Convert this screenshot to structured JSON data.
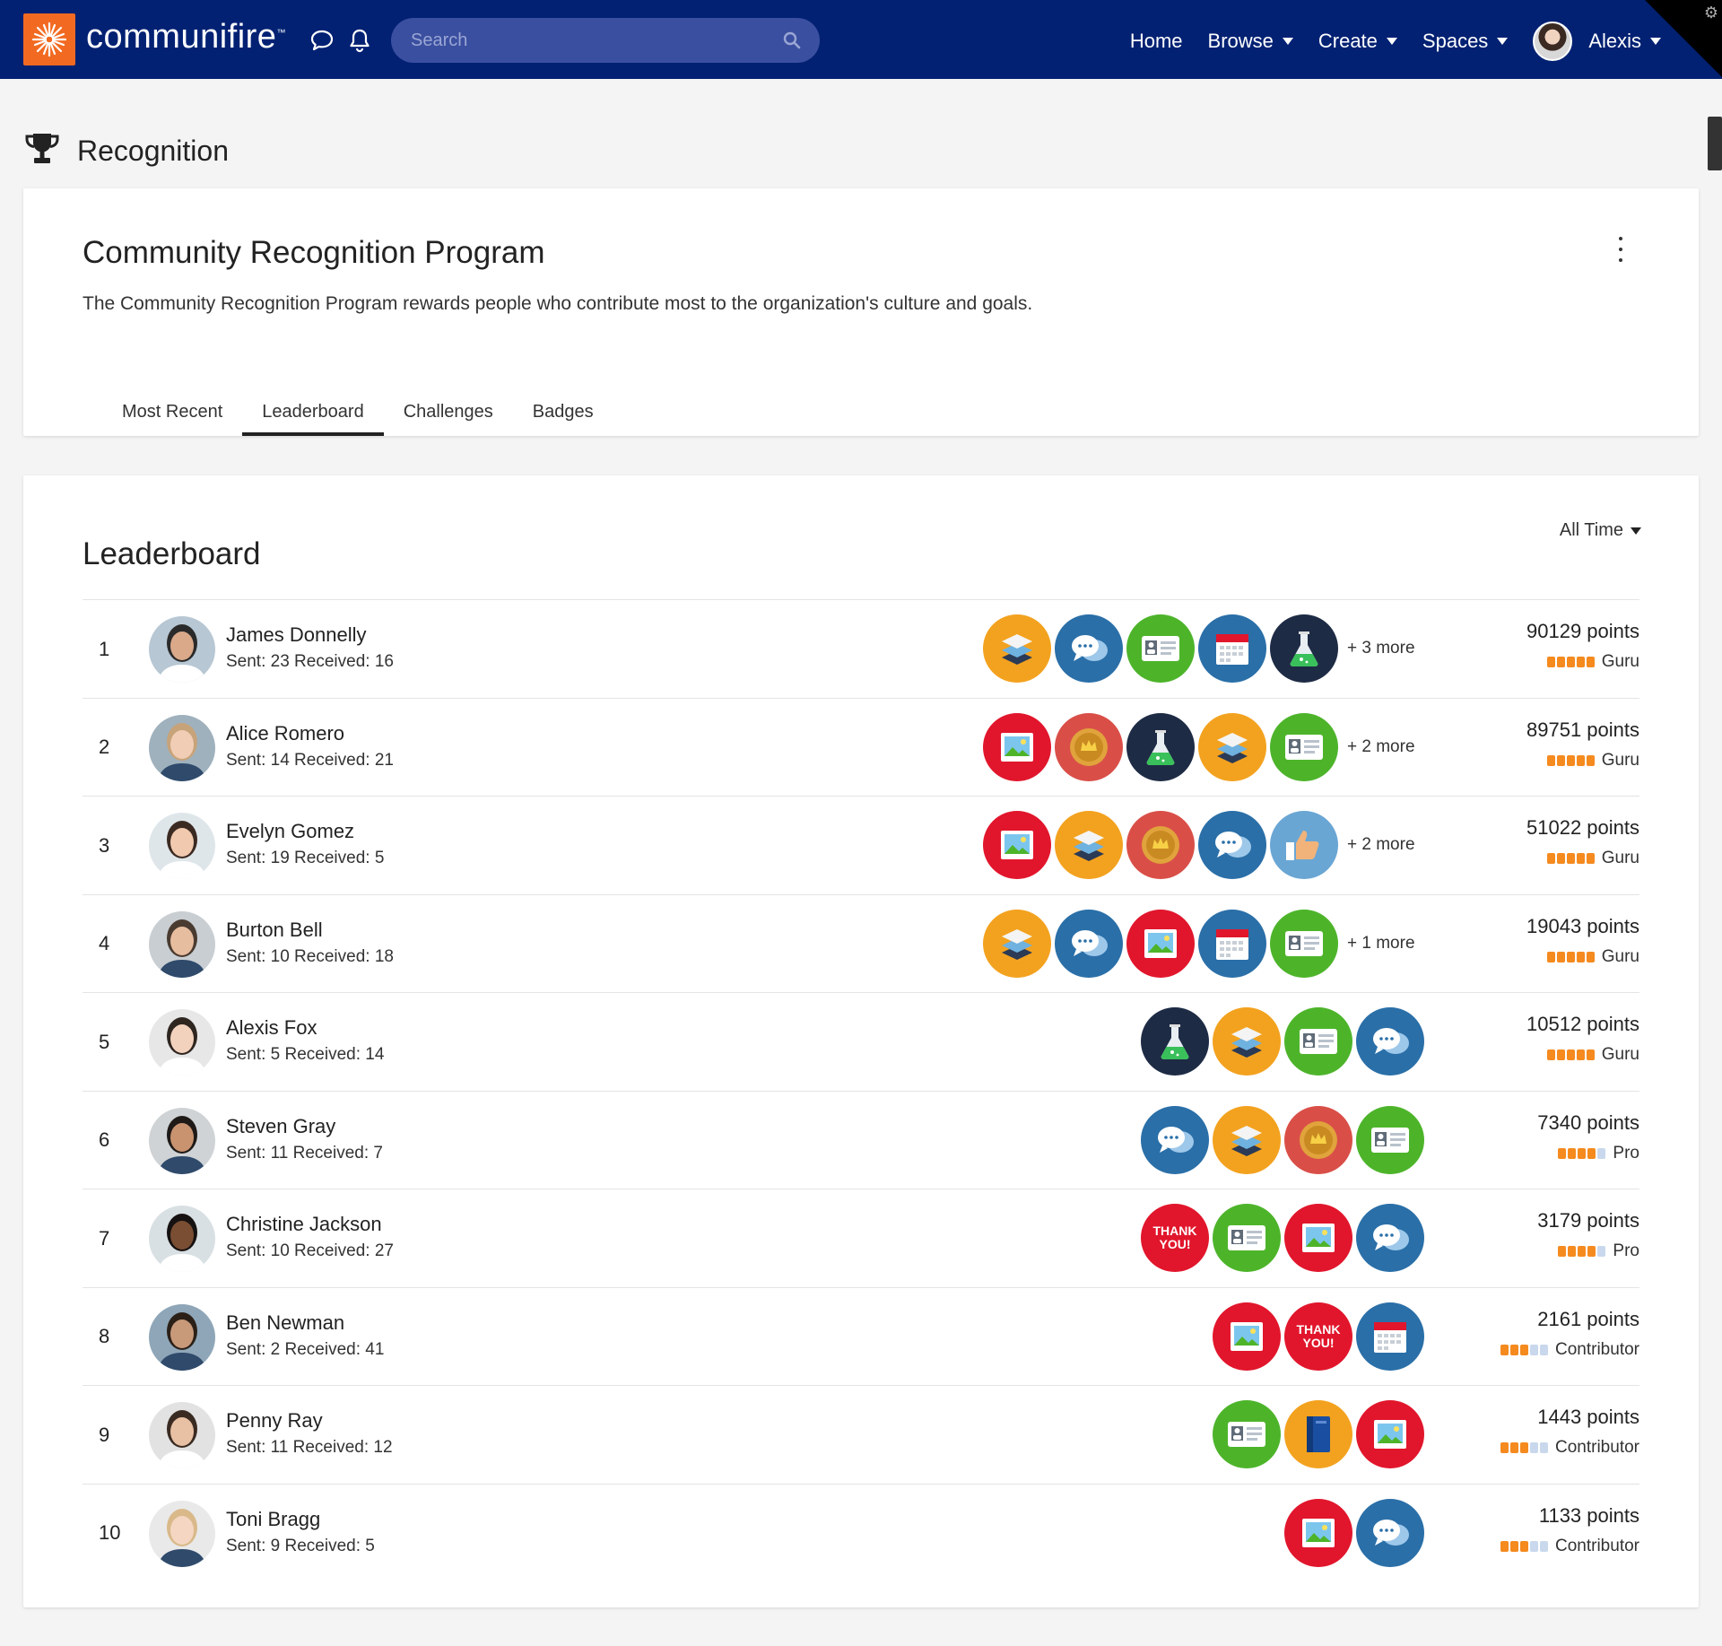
{
  "nav": {
    "brand": "communifire",
    "brand_tm": "™",
    "search_placeholder": "Search",
    "links": [
      {
        "label": "Home",
        "dropdown": false
      },
      {
        "label": "Browse",
        "dropdown": true
      },
      {
        "label": "Create",
        "dropdown": true
      },
      {
        "label": "Spaces",
        "dropdown": true
      }
    ],
    "user": "Alexis"
  },
  "page": {
    "title": "Recognition"
  },
  "program": {
    "title": "Community Recognition Program",
    "description": "The Community Recognition Program rewards people who contribute most to the organization's culture and goals.",
    "tabs": [
      "Most Recent",
      "Leaderboard",
      "Challenges",
      "Badges"
    ],
    "active_tab": "Leaderboard"
  },
  "leaderboard": {
    "title": "Leaderboard",
    "time_filter": "All Time",
    "rows": [
      {
        "rank": "1",
        "name": "James Donnelly",
        "stats": "Sent: 23 Received: 16",
        "badges": [
          "layers",
          "chat",
          "idcard",
          "calendar",
          "flask"
        ],
        "more": "+ 3 more",
        "points": "90129 points",
        "level": "Guru",
        "level_pips": 5
      },
      {
        "rank": "2",
        "name": "Alice Romero",
        "stats": "Sent: 14 Received: 21",
        "badges": [
          "image",
          "medal",
          "flask",
          "layers",
          "idcard"
        ],
        "more": "+ 2 more",
        "points": "89751 points",
        "level": "Guru",
        "level_pips": 5
      },
      {
        "rank": "3",
        "name": "Evelyn Gomez",
        "stats": "Sent: 19 Received: 5",
        "badges": [
          "image",
          "layers",
          "medal",
          "chat",
          "thumbsup"
        ],
        "more": "+ 2 more",
        "points": "51022 points",
        "level": "Guru",
        "level_pips": 5
      },
      {
        "rank": "4",
        "name": "Burton Bell",
        "stats": "Sent: 10 Received: 18",
        "badges": [
          "layers",
          "chat",
          "image",
          "calendar",
          "idcard"
        ],
        "more": "+ 1 more",
        "points": "19043 points",
        "level": "Guru",
        "level_pips": 5
      },
      {
        "rank": "5",
        "name": "Alexis Fox",
        "stats": "Sent: 5 Received: 14",
        "badges": [
          "flask",
          "layers",
          "idcard",
          "chat"
        ],
        "more": "",
        "points": "10512 points",
        "level": "Guru",
        "level_pips": 5
      },
      {
        "rank": "6",
        "name": "Steven Gray",
        "stats": "Sent: 11 Received: 7",
        "badges": [
          "chat",
          "layers",
          "medal",
          "idcard"
        ],
        "more": "",
        "points": "7340 points",
        "level": "Pro",
        "level_pips": 4
      },
      {
        "rank": "7",
        "name": "Christine Jackson",
        "stats": "Sent: 10 Received: 27",
        "badges": [
          "thankyou",
          "idcard",
          "image",
          "chat"
        ],
        "more": "",
        "points": "3179 points",
        "level": "Pro",
        "level_pips": 4
      },
      {
        "rank": "8",
        "name": "Ben Newman",
        "stats": "Sent: 2 Received: 41",
        "badges": [
          "image",
          "thankyou",
          "calendar"
        ],
        "more": "",
        "points": "2161 points",
        "level": "Contributor",
        "level_pips": 3
      },
      {
        "rank": "9",
        "name": "Penny Ray",
        "stats": "Sent: 11 Received: 12",
        "badges": [
          "idcard",
          "book",
          "image"
        ],
        "more": "",
        "points": "1443 points",
        "level": "Contributor",
        "level_pips": 3
      },
      {
        "rank": "10",
        "name": "Toni Bragg",
        "stats": "Sent: 9 Received: 5",
        "badges": [
          "image",
          "chat"
        ],
        "more": "",
        "points": "1133 points",
        "level": "Contributor",
        "level_pips": 3
      }
    ]
  },
  "badge_text": {
    "thankyou": [
      "THANK",
      "YOU!"
    ]
  },
  "colors": {
    "nav_bg": "#022173",
    "logo_orange": "#f26a21",
    "badge_orange": "#f3a21f",
    "badge_blue": "#2a6fa8",
    "badge_green": "#4db42a",
    "badge_red": "#e1162c",
    "badge_medal": "#d94f48",
    "badge_navy": "#1e2b45",
    "badge_lightblue": "#6aa6d4",
    "level_active": "#f58a1f",
    "level_inactive": "#c9d8ec"
  }
}
